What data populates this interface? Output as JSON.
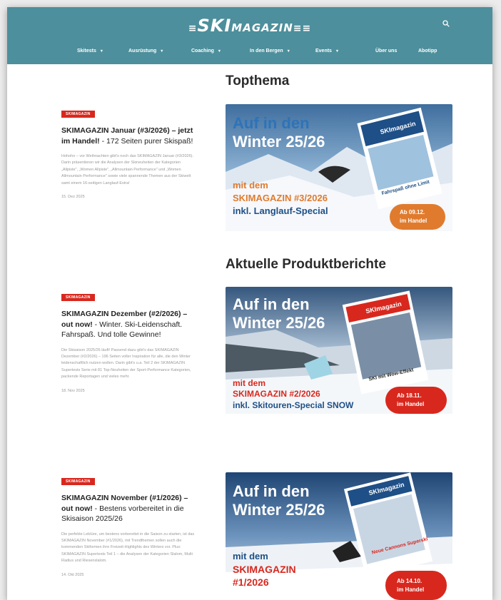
{
  "header": {
    "logo_prefix": "≡",
    "logo_ski": "SKI",
    "logo_rest": "MAGAZIN",
    "logo_suffix": "≡≡",
    "search_icon": "search-icon",
    "nav": [
      {
        "label": "Skitests",
        "has_caret": true
      },
      {
        "label": "Ausrüstung",
        "has_caret": true
      },
      {
        "label": "Coaching",
        "has_caret": true
      },
      {
        "label": "In den Bergen",
        "has_caret": true
      },
      {
        "label": "Events",
        "has_caret": true
      },
      {
        "label": "Über uns",
        "has_caret": false
      },
      {
        "label": "Abotipp",
        "has_caret": false
      }
    ],
    "caret": "▾"
  },
  "sections": {
    "topthema": "Topthema",
    "produktberichte": "Aktuelle Produktberichte"
  },
  "articles": [
    {
      "tag": "SKIMAGAZIN",
      "title_bold": "SKIMAGAZIN Januar (#3/2026) – jetzt im Handel!",
      "title_rest": " - 172 Seiten purer Skispaß!",
      "excerpt": "Hohoho – vor Weihnachten gibt's noch das SKIMAGAZIN Januar (#3/2026). Darin präsentieren wir die Analysen der Skineuheiten der Kategorien „Allpiste\", „Women Allpiste\", „Allmountain Performance\" und „Women Allmountain Performance\" sowie viele spannende Themen aus der Skiwelt samt einem 16-seitigen Langlauf-Extra!",
      "date": "15. Dez 2025",
      "banner": {
        "headline1": "Auf in den",
        "headline2": "Winter 25/26",
        "line1": "mit dem",
        "line2": "SKIMAGAZIN #3/2026",
        "line3": "inkl. Langlauf-Special",
        "badge1": "Ab 09.12.",
        "badge2": "im Handel",
        "cover_brand": "SKImagazin",
        "cover_line": "Fahrspaß ohne Limit",
        "accent": "#e07b2e"
      }
    },
    {
      "tag": "SKIMAGAZIN",
      "title_bold": "SKIMAGAZIN Dezember (#2/2026) – out now!",
      "title_rest": " - Winter. Ski-Leidenschaft. Fahrspaß. Und tolle Gewinne!",
      "excerpt": "Die Skisaison 2025/26 läuft! Passend dazu gibt's das SKIMAGAZIN Dezember (#2/2026) – 196 Seiten voller Inspiration für alle, die den Winter leidenschaftlich nutzen wollen. Darin gibt's u.a. Teil 2 der SKIMAGAZIN Supertests Serie mit 81 Top-Neuheiten der Sport-Performance Kategorien, packende Reportagen und vieles mehr.",
      "date": "18. Nov 2025",
      "banner": {
        "headline1": "Auf in den",
        "headline2": "Winter 25/26",
        "line1": "mit dem",
        "line2": "SKIMAGAZIN #2/2026",
        "line3": "inkl. Skitouren-Special SNOW",
        "badge1": "Ab 18.11.",
        "badge2": "im Handel",
        "cover_brand": "SKImagazin",
        "cover_line": "SKI mit Wow-Effekt",
        "accent": "#d8281e"
      }
    },
    {
      "tag": "SKIMAGAZIN",
      "title_bold": "SKIMAGAZIN November (#1/2026) – out now!",
      "title_rest": " - Bestens vorbereitet in die Skisaison 2025/26",
      "excerpt": "Die perfekte Lektüre, um bestens vorbereitet in die Saison zu starten, ist das SKIMAGAZIN November (#1/2026), mit Trendthemen sollen auch die kommenden Skiformen ihre Freizeit-Highlights des Winters vor. Plus: SKIMAGAZIN Supertests Teil 1 – die Analysen der Kategorien Slalom, Multi Radius und Riesenslalom.",
      "date": "14. Okt 2025",
      "banner": {
        "headline1": "Auf in den",
        "headline2": "Winter 25/26",
        "line1": "mit dem",
        "line2": "SKIMAGAZIN",
        "line3": "#1/2026",
        "badge1": "Ab 14.10.",
        "badge2": "im Handel",
        "cover_brand": "SKImagazin",
        "cover_line": "Neue Cannons Superski",
        "accent": "#d8281e"
      }
    }
  ]
}
